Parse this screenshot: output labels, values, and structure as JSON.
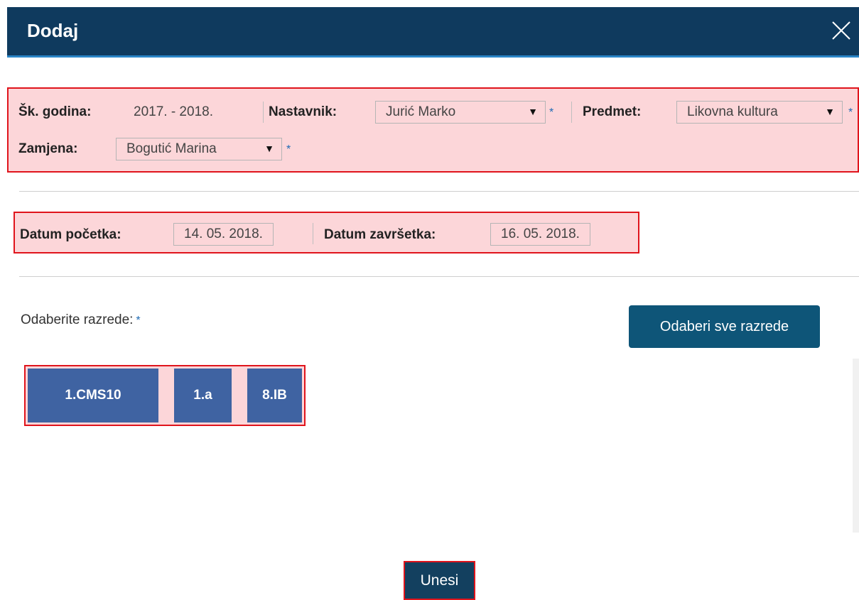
{
  "dialog": {
    "title": "Dodaj"
  },
  "filters": {
    "school_year_label": "Šk. godina:",
    "school_year_value": "2017. - 2018.",
    "teacher_label": "Nastavnik:",
    "teacher_value": "Jurić Marko",
    "subject_label": "Predmet:",
    "subject_value": "Likovna kultura",
    "substitute_label": "Zamjena:",
    "substitute_value": "Bogutić Marina",
    "required_marker": "*",
    "dropdown_arrow": "▼"
  },
  "dates": {
    "start_label": "Datum početka:",
    "start_value": "14. 05. 2018.",
    "end_label": "Datum završetka:",
    "end_value": "16. 05. 2018."
  },
  "classes": {
    "prompt": "Odaberite razrede:",
    "required_marker": "*",
    "select_all_label": "Odaberi sve razrede",
    "items": [
      "1.CMS10",
      "1.a",
      "8.IB"
    ]
  },
  "footer": {
    "submit_label": "Unesi"
  },
  "colors": {
    "header_bg": "#0f3a5e",
    "header_accent": "#2a84c6",
    "highlight_bg": "#fcd6d9",
    "highlight_border": "#e0141c",
    "class_chip": "#3f63a2",
    "primary_button": "#0e5578",
    "required_star": "#1f6bb5"
  }
}
